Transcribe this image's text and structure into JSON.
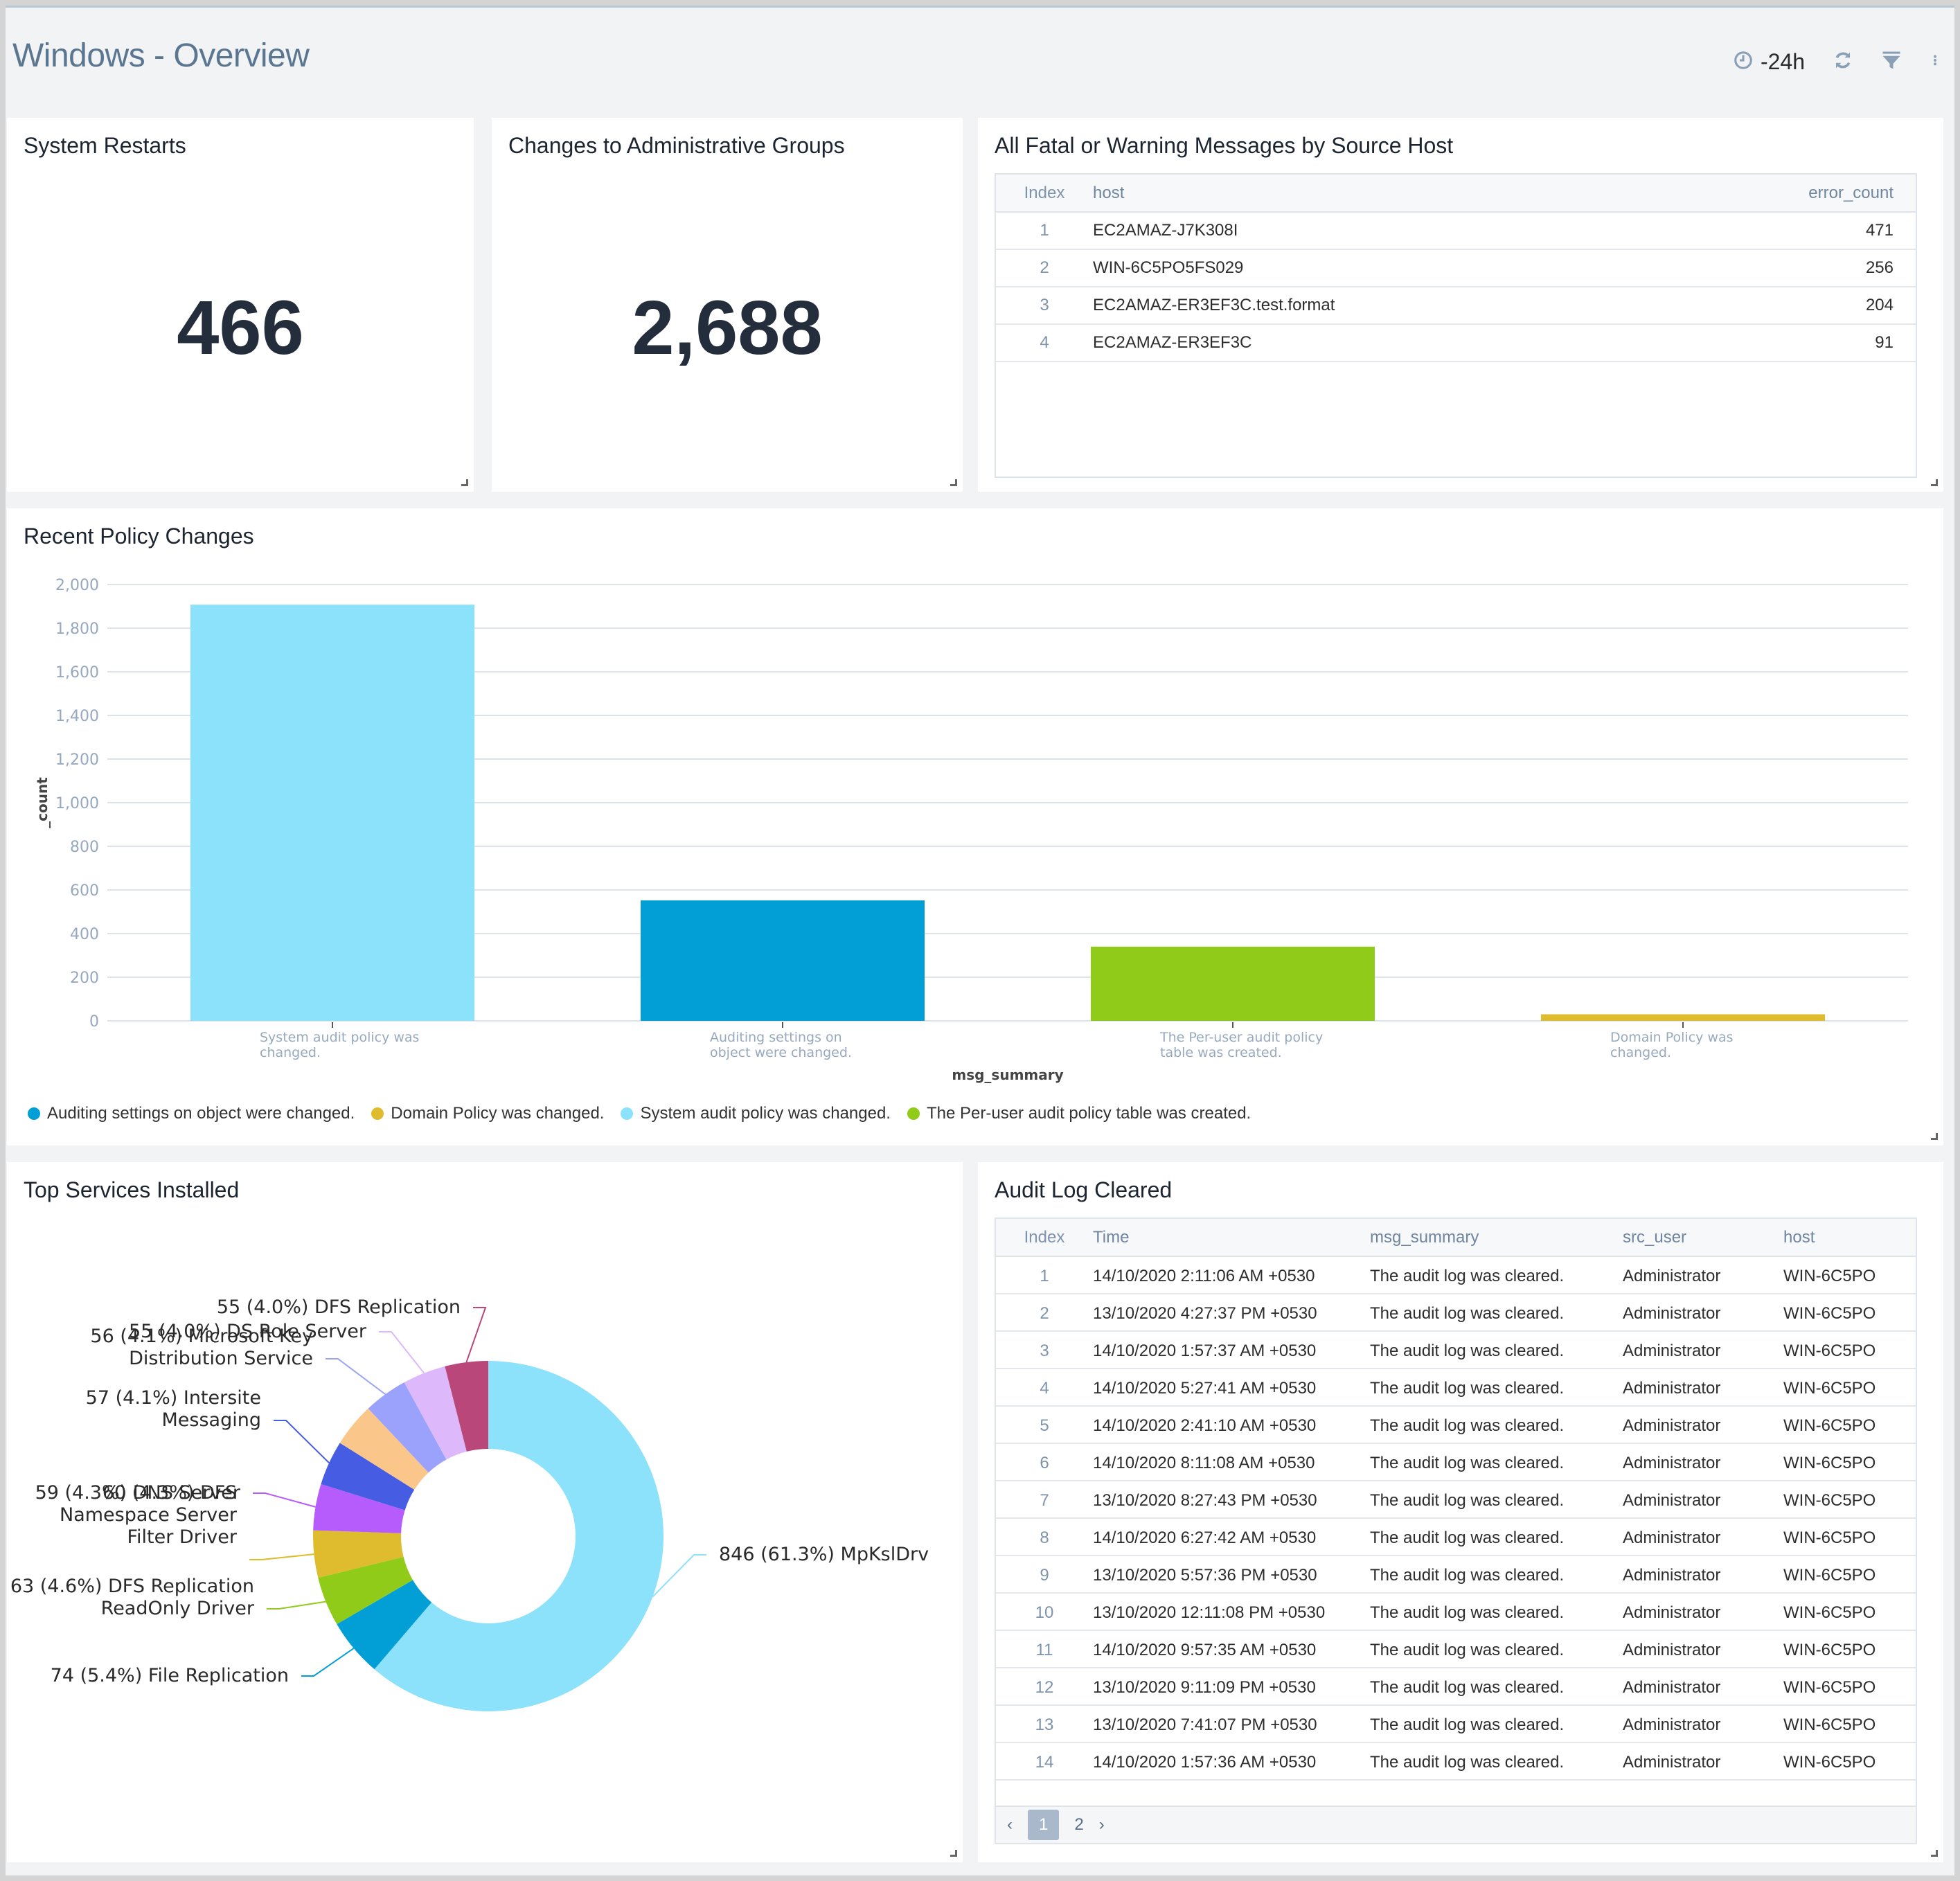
{
  "header": {
    "title": "Windows - Overview",
    "time_range": "-24h",
    "icons": [
      "clock-icon",
      "refresh-icon",
      "filter-icon",
      "more-vertical-icon"
    ]
  },
  "panels": {
    "system_restarts": {
      "title": "System Restarts",
      "value": "466"
    },
    "admin_groups": {
      "title": "Changes to Administrative Groups",
      "value": "2,688"
    },
    "fatal_warning": {
      "title": "All Fatal or Warning Messages by Source Host",
      "columns": [
        "Index",
        "host",
        "error_count"
      ],
      "rows": [
        {
          "index": "1",
          "host": "EC2AMAZ-J7K308I",
          "error_count": "471"
        },
        {
          "index": "2",
          "host": "WIN-6C5PO5FS029",
          "error_count": "256"
        },
        {
          "index": "3",
          "host": "EC2AMAZ-ER3EF3C.test.format",
          "error_count": "204"
        },
        {
          "index": "4",
          "host": "EC2AMAZ-ER3EF3C",
          "error_count": "91"
        }
      ]
    },
    "policy_changes": {
      "title": "Recent Policy Changes"
    },
    "top_services": {
      "title": "Top Services Installed"
    },
    "audit_log": {
      "title": "Audit Log Cleared",
      "columns": [
        "Index",
        "Time",
        "msg_summary",
        "src_user",
        "host"
      ],
      "rows": [
        {
          "index": "1",
          "time": "14/10/2020 2:11:06 AM +0530",
          "msg": "The audit log was cleared.",
          "user": "Administrator",
          "host": "WIN-6C5PO"
        },
        {
          "index": "2",
          "time": "13/10/2020 4:27:37 PM +0530",
          "msg": "The audit log was cleared.",
          "user": "Administrator",
          "host": "WIN-6C5PO"
        },
        {
          "index": "3",
          "time": "14/10/2020 1:57:37 AM +0530",
          "msg": "The audit log was cleared.",
          "user": "Administrator",
          "host": "WIN-6C5PO"
        },
        {
          "index": "4",
          "time": "14/10/2020 5:27:41 AM +0530",
          "msg": "The audit log was cleared.",
          "user": "Administrator",
          "host": "WIN-6C5PO"
        },
        {
          "index": "5",
          "time": "14/10/2020 2:41:10 AM +0530",
          "msg": "The audit log was cleared.",
          "user": "Administrator",
          "host": "WIN-6C5PO"
        },
        {
          "index": "6",
          "time": "14/10/2020 8:11:08 AM +0530",
          "msg": "The audit log was cleared.",
          "user": "Administrator",
          "host": "WIN-6C5PO"
        },
        {
          "index": "7",
          "time": "13/10/2020 8:27:43 PM +0530",
          "msg": "The audit log was cleared.",
          "user": "Administrator",
          "host": "WIN-6C5PO"
        },
        {
          "index": "8",
          "time": "14/10/2020 6:27:42 AM +0530",
          "msg": "The audit log was cleared.",
          "user": "Administrator",
          "host": "WIN-6C5PO"
        },
        {
          "index": "9",
          "time": "13/10/2020 5:57:36 PM +0530",
          "msg": "The audit log was cleared.",
          "user": "Administrator",
          "host": "WIN-6C5PO"
        },
        {
          "index": "10",
          "time": "13/10/2020 12:11:08 PM +0530",
          "msg": "The audit log was cleared.",
          "user": "Administrator",
          "host": "WIN-6C5PO"
        },
        {
          "index": "11",
          "time": "14/10/2020 9:57:35 AM +0530",
          "msg": "The audit log was cleared.",
          "user": "Administrator",
          "host": "WIN-6C5PO"
        },
        {
          "index": "12",
          "time": "13/10/2020 9:11:09 PM +0530",
          "msg": "The audit log was cleared.",
          "user": "Administrator",
          "host": "WIN-6C5PO"
        },
        {
          "index": "13",
          "time": "13/10/2020 7:41:07 PM +0530",
          "msg": "The audit log was cleared.",
          "user": "Administrator",
          "host": "WIN-6C5PO"
        },
        {
          "index": "14",
          "time": "14/10/2020 1:57:36 AM +0530",
          "msg": "The audit log was cleared.",
          "user": "Administrator",
          "host": "WIN-6C5PO"
        }
      ],
      "pagination": {
        "prev": "‹",
        "pages": [
          "1",
          "2"
        ],
        "current": "1",
        "next": "›"
      }
    }
  },
  "chart_data": [
    {
      "type": "bar",
      "title": "Recent Policy Changes",
      "xlabel": "msg_summary",
      "ylabel": "_count",
      "ylim": [
        0,
        2000
      ],
      "yticks": [
        "0",
        "200",
        "400",
        "600",
        "800",
        "1,000",
        "1,200",
        "1,400",
        "1,600",
        "1,800",
        "2,000"
      ],
      "grid": true,
      "categories": [
        "System audit policy was changed.",
        "Auditing settings on object were changed.",
        "The Per-user audit policy table was created.",
        "Domain Policy was changed."
      ],
      "category_lines": [
        [
          "System audit policy was",
          "changed."
        ],
        [
          "Auditing settings on",
          "object were changed."
        ],
        [
          "The Per-user audit policy",
          "table was created."
        ],
        [
          "Domain Policy was",
          "changed."
        ]
      ],
      "values": [
        1908,
        552,
        340,
        30
      ],
      "colors": [
        "#8ce1fb",
        "#029fd6",
        "#90cb1a",
        "#dfbc2e"
      ],
      "legend_position": "bottom-left",
      "legend": [
        {
          "label": "Auditing settings on object were changed.",
          "color": "#029fd6"
        },
        {
          "label": "Domain Policy was changed.",
          "color": "#dfbc2e"
        },
        {
          "label": "System audit policy was changed.",
          "color": "#8ce1fb"
        },
        {
          "label": "The Per-user audit policy table was created.",
          "color": "#90cb1a"
        }
      ]
    },
    {
      "type": "pie",
      "title": "Top Services Installed",
      "donut": true,
      "slices": [
        {
          "label": "MpKslDrv",
          "value": 846,
          "percent": "61.3%",
          "color": "#8ce1fb",
          "text": [
            "846 (61.3%) MpKslDrv"
          ]
        },
        {
          "label": "File Replication",
          "value": 74,
          "percent": "5.4%",
          "color": "#029fd6",
          "text": [
            "74 (5.4%) File Replication"
          ]
        },
        {
          "label": "DFS Replication ReadOnly Driver",
          "value": 63,
          "percent": "4.6%",
          "color": "#90cb1a",
          "text": [
            "63 (4.6%) DFS Replication",
            "ReadOnly Driver"
          ]
        },
        {
          "label": "DFS Namespace Server Filter Driver",
          "value": 60,
          "percent": "4.3%",
          "color": "#dfbc2e",
          "text": [
            "60 (4.3%) DFS",
            "Namespace Server",
            "Filter Driver"
          ]
        },
        {
          "label": "DNS Server",
          "value": 59,
          "percent": "4.3%",
          "color": "#b65cfc",
          "text": [
            "59 (4.3%) DNS Server"
          ]
        },
        {
          "label": "Intersite Messaging",
          "value": 57,
          "percent": "4.1%",
          "color": "#465de3",
          "text": [
            "57 (4.1%) Intersite",
            "Messaging"
          ]
        },
        {
          "label": "",
          "value": 56,
          "percent": "",
          "color": "#fbc68a",
          "text": []
        },
        {
          "label": "Microsoft Key Distribution Service",
          "value": 56,
          "percent": "4.1%",
          "color": "#9aa2fc",
          "text": [
            "56 (4.1%) Microsoft Key",
            "Distribution Service"
          ]
        },
        {
          "label": "DS Role Server",
          "value": 55,
          "percent": "4.0%",
          "color": "#ddb9fc",
          "text": [
            "55 (4.0%) DS Role Server"
          ]
        },
        {
          "label": "DFS Replication",
          "value": 55,
          "percent": "4.0%",
          "color": "#b9477a",
          "text": [
            "55 (4.0%) DFS Replication"
          ]
        }
      ]
    }
  ]
}
